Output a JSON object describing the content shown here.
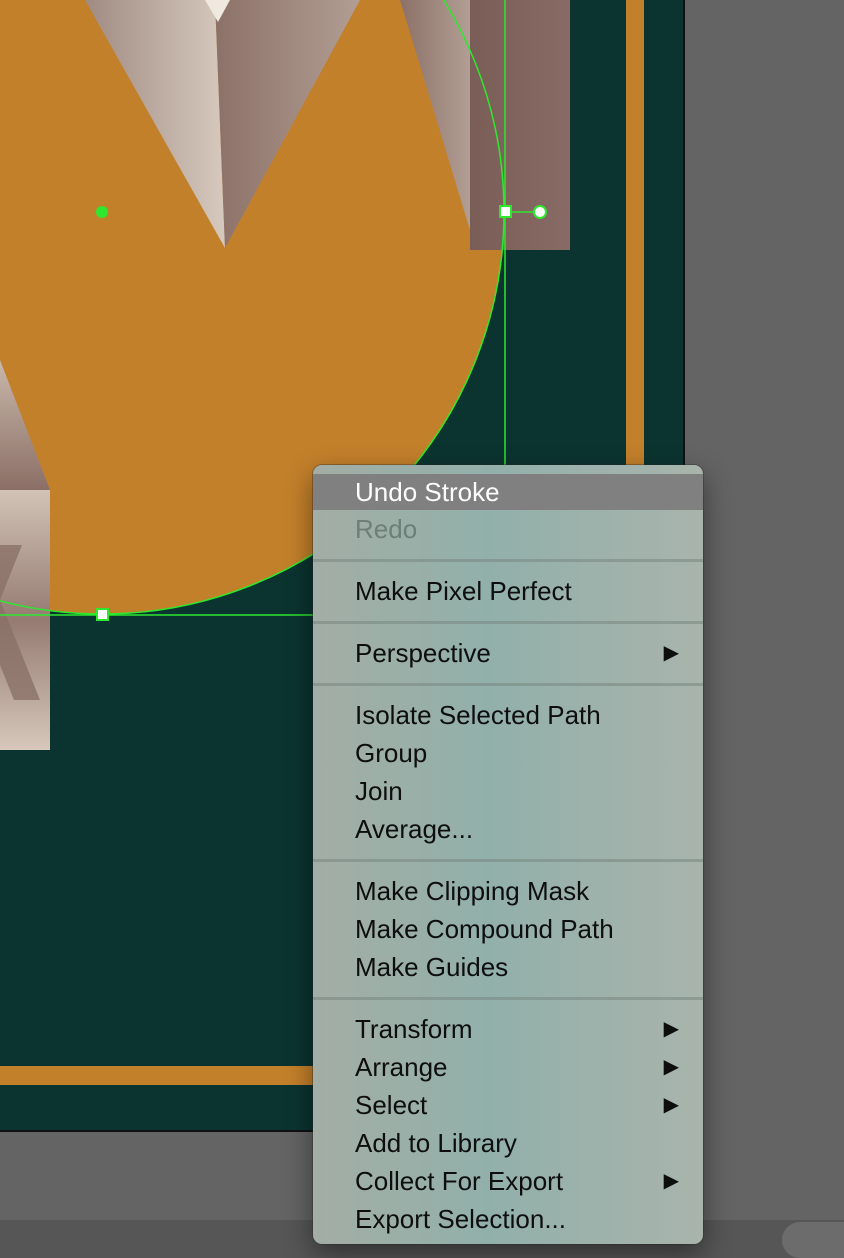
{
  "colors": {
    "workspace": "#646464",
    "artboard": "#0b3430",
    "accent_orange": "#c3802b",
    "selection_green": "#2ee82e",
    "menu_highlight": "#808080"
  },
  "context_menu": {
    "groups": [
      [
        {
          "label": "Undo Stroke",
          "state": "highlighted"
        },
        {
          "label": "Redo",
          "state": "disabled"
        }
      ],
      [
        {
          "label": "Make Pixel Perfect"
        }
      ],
      [
        {
          "label": "Perspective",
          "submenu": true
        }
      ],
      [
        {
          "label": "Isolate Selected Path"
        },
        {
          "label": "Group"
        },
        {
          "label": "Join"
        },
        {
          "label": "Average..."
        }
      ],
      [
        {
          "label": "Make Clipping Mask"
        },
        {
          "label": "Make Compound Path"
        },
        {
          "label": "Make Guides"
        }
      ],
      [
        {
          "label": "Transform",
          "submenu": true
        },
        {
          "label": "Arrange",
          "submenu": true
        },
        {
          "label": "Select",
          "submenu": true
        },
        {
          "label": "Add to Library"
        },
        {
          "label": "Collect For Export",
          "submenu": true
        },
        {
          "label": "Export Selection..."
        }
      ]
    ],
    "submenu_glyph": "▶"
  },
  "icons": {
    "submenu": "triangle-right-icon",
    "anchor": "square-anchor-point",
    "center": "center-point-dot"
  }
}
